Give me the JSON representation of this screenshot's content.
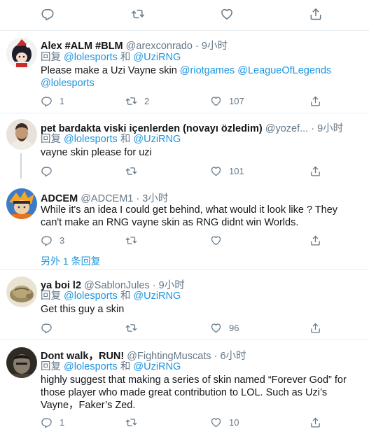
{
  "tweets": [
    {
      "name": "Alex #ALM #BLM",
      "handle": "@arexconrado",
      "time": "· 9小时",
      "reply_prefix": "回复",
      "reply_to_1": "@lolesports",
      "reply_and": "和",
      "reply_to_2": "@UziRNG",
      "text_1a": "Please make a Uzi Vayne skin ",
      "text_1b": "@riotgames",
      "text_1c": " ",
      "text_1d": "@LeagueOfLegends",
      "text_2": "@lolesports",
      "replies": "1",
      "retweets": "2",
      "likes": "107"
    },
    {
      "name": "pet bardakta viski içenlerden (novayı özledim)",
      "handle": "@yozef...",
      "time": "· 9小时",
      "reply_prefix": "回复",
      "reply_to_1": "@lolesports",
      "reply_and": "和",
      "reply_to_2": "@UziRNG",
      "text_1": "vayne skin please for uzi",
      "replies": "",
      "retweets": "",
      "likes": "101"
    },
    {
      "name": "ADCEM",
      "handle": "@ADCEM1",
      "time": "· 3小时",
      "text_1": "While it's an idea I could get behind, what would it look like ? They",
      "text_2": "can't make an RNG vayne skin as RNG didnt win Worlds.",
      "replies": "3",
      "retweets": "",
      "likes": "",
      "more_replies": "另外 1 条回复"
    },
    {
      "name": "ya boi l2",
      "handle": "@SablonJules",
      "time": "· 9小时",
      "reply_prefix": "回复",
      "reply_to_1": "@lolesports",
      "reply_and": "和",
      "reply_to_2": "@UziRNG",
      "text_1": "Get this guy a skin",
      "replies": "",
      "retweets": "",
      "likes": "96"
    },
    {
      "name": "Dont walk，RUN!",
      "handle": "@FightingMuscats",
      "time": "· 6小时",
      "reply_prefix": "回复",
      "reply_to_1": "@lolesports",
      "reply_and": "和",
      "reply_to_2": "@UziRNG",
      "text_1": "highly suggest that making a series of skin named “Forever God” for",
      "text_2": "those player who made great contribution to LOL. Such as Uzi’s",
      "text_3": "Vayne，Faker’s Zed.",
      "replies": "1",
      "retweets": "",
      "likes": "10"
    }
  ],
  "colors": {
    "link": "#1b95e0",
    "muted": "#657786",
    "divider": "#e6ecf0"
  },
  "icons": [
    "reply-icon",
    "retweet-icon",
    "like-icon",
    "share-icon"
  ]
}
